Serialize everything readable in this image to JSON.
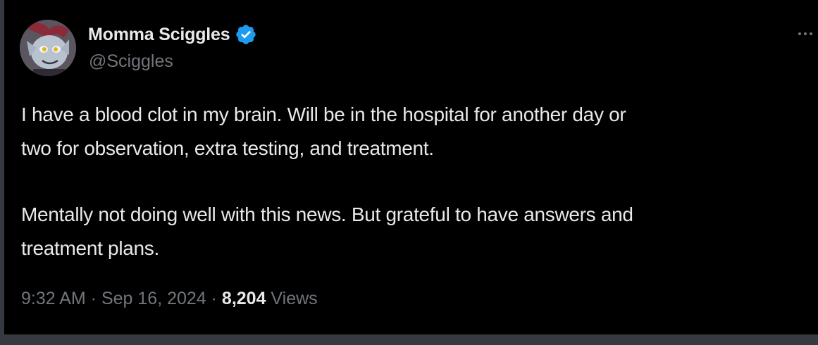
{
  "author": {
    "display_name": "Momma Sciggles",
    "handle": "@Sciggles",
    "verified": true
  },
  "tweet": {
    "paragraphs": [
      [
        "I have a blood clot in my brain. Will be in the hospital for another day or",
        "two for observation, extra testing, and treatment."
      ],
      [
        "Mentally not doing well with this news. But grateful to have answers and",
        "treatment plans."
      ]
    ],
    "time": "9:32 AM",
    "separator": " · ",
    "date": "Sep 16, 2024",
    "views_count": "8,204",
    "views_label": " Views"
  },
  "colors": {
    "background": "#000000",
    "text_primary": "#e7e9ea",
    "text_secondary": "#71767b",
    "verified_badge": "#1d9bf0"
  },
  "icons": {
    "verified": "verified-badge-icon",
    "more": "more-options-icon"
  }
}
